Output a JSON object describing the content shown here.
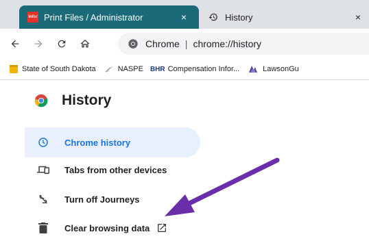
{
  "tabs": [
    {
      "title": "Print Files / Administrator",
      "favicon": "infor",
      "close": "×",
      "active": true
    },
    {
      "title": "History",
      "favicon": "history-icon",
      "close": "×",
      "active": false
    }
  ],
  "favicon_text": "infor",
  "toolbar": {
    "omnibox_label": "Chrome",
    "separator": "|",
    "url": "chrome://history"
  },
  "bookmarks": [
    {
      "label": "State of South Dakota",
      "icon": "folder-icon"
    },
    {
      "label": "NASPE",
      "icon": "bird-icon"
    },
    {
      "label": "Compensation Infor...",
      "prefix": "BHR",
      "icon": "bhr-icon"
    },
    {
      "label": "LawsonGu",
      "icon": "lawson-icon"
    }
  ],
  "page": {
    "title": "History",
    "menu": [
      {
        "label": "Chrome history",
        "icon": "clock-icon",
        "selected": true
      },
      {
        "label": "Tabs from other devices",
        "icon": "devices-icon",
        "selected": false
      },
      {
        "label": "Turn off Journeys",
        "icon": "journeys-off-icon",
        "selected": false
      },
      {
        "label": "Clear browsing data",
        "icon": "trash-icon",
        "selected": false
      }
    ]
  },
  "colors": {
    "active_tab": "#1a6a7a",
    "selected_item_bg": "#e8f0fe",
    "selected_item_text": "#1a73e8",
    "arrow": "#6a2ea8"
  }
}
